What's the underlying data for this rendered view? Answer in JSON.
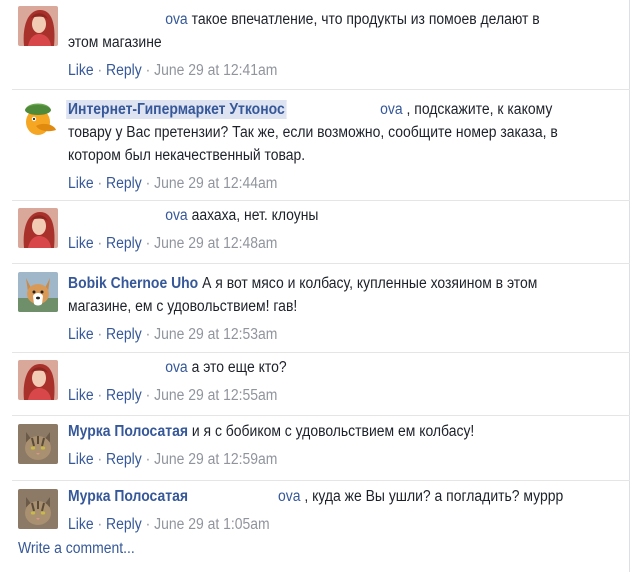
{
  "comments": [
    {
      "avatar": "woman-redhair-avatar",
      "author": "",
      "lastname_suffix": "ova",
      "lines": [
        "такое впечатление, что продукты из помоев делают в",
        "этом магазине"
      ],
      "like": "Like",
      "dot": "·",
      "reply": "Reply",
      "dot2": "·",
      "time": "June 29 at 12:41am"
    },
    {
      "avatar": "utkonos-platypus-logo",
      "author": "Интернет-Гипермаркет Утконос",
      "lastname_suffix": "ova",
      "lines": [
        ", подскажите, к какому",
        "товару у Вас претензии? Так же, если возможно, сообщите номер заказа, в",
        "котором был некачественный товар."
      ],
      "like": "Like",
      "dot": "·",
      "reply": "Reply",
      "dot2": "·",
      "time": "June 29 at 12:44am"
    },
    {
      "avatar": "woman-redhair-avatar",
      "author": "",
      "lastname_suffix": "ova",
      "lines": [
        "аахаха, нет. клоуны"
      ],
      "like": "Like",
      "dot": "·",
      "reply": "Reply",
      "dot2": "·",
      "time": "June 29 at 12:48am"
    },
    {
      "avatar": "corgi-dog-avatar",
      "author": "Bobik Chernoe Uho",
      "lines": [
        "А я вот мясо и колбасу, купленные хозяином в этом",
        "магазине, ем с удовольствием! гав!"
      ],
      "like": "Like",
      "dot": "·",
      "reply": "Reply",
      "dot2": "·",
      "time": "June 29 at 12:53am"
    },
    {
      "avatar": "woman-redhair-avatar",
      "author": "",
      "lastname_suffix": "ova",
      "lines": [
        "а это еще кто?"
      ],
      "like": "Like",
      "dot": "·",
      "reply": "Reply",
      "dot2": "·",
      "time": "June 29 at 12:55am"
    },
    {
      "avatar": "tabby-cat-avatar",
      "author": "Мурка Полосатая",
      "lines": [
        "и я с бобиком с удовольствием ем колбасу!"
      ],
      "like": "Like",
      "dot": "·",
      "reply": "Reply",
      "dot2": "·",
      "time": "June 29 at 12:59am"
    },
    {
      "avatar": "tabby-cat-avatar",
      "author": "Мурка Полосатая",
      "lastname_suffix": "ova",
      "lines": [
        ", куда же Вы ушли? а погладить? муррр"
      ],
      "like": "Like",
      "dot": "·",
      "reply": "Reply",
      "dot2": "·",
      "time": "June 29 at 1:05am"
    }
  ],
  "write_comment": "Write a comment...",
  "colors": {
    "link": "#365899",
    "text": "#1d2129",
    "meta": "#90949c",
    "mention_highlight": "#dde3f1"
  }
}
